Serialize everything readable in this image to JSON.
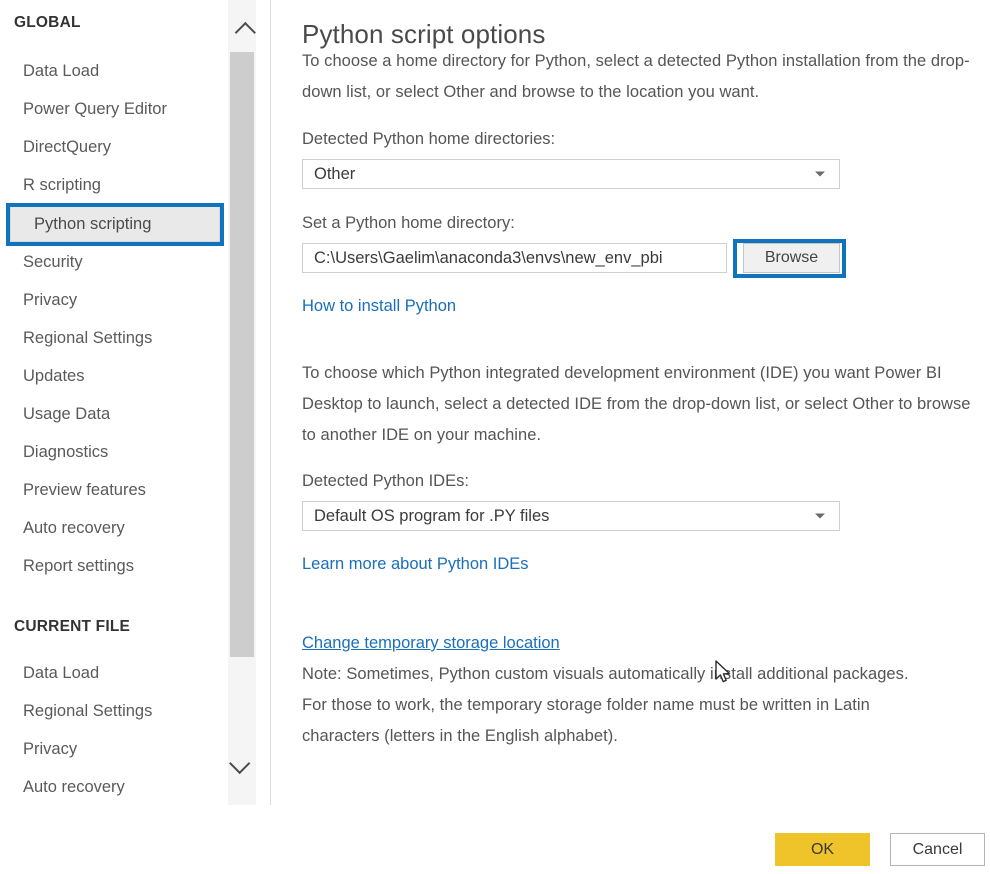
{
  "sidebar": {
    "groups": [
      {
        "title": "GLOBAL",
        "items": [
          {
            "label": "Data Load",
            "selected": false
          },
          {
            "label": "Power Query Editor",
            "selected": false
          },
          {
            "label": "DirectQuery",
            "selected": false
          },
          {
            "label": "R scripting",
            "selected": false
          },
          {
            "label": "Python scripting",
            "selected": true
          },
          {
            "label": "Security",
            "selected": false
          },
          {
            "label": "Privacy",
            "selected": false
          },
          {
            "label": "Regional Settings",
            "selected": false
          },
          {
            "label": "Updates",
            "selected": false
          },
          {
            "label": "Usage Data",
            "selected": false
          },
          {
            "label": "Diagnostics",
            "selected": false
          },
          {
            "label": "Preview features",
            "selected": false
          },
          {
            "label": "Auto recovery",
            "selected": false
          },
          {
            "label": "Report settings",
            "selected": false
          }
        ]
      },
      {
        "title": "CURRENT FILE",
        "items": [
          {
            "label": "Data Load",
            "selected": false
          },
          {
            "label": "Regional Settings",
            "selected": false
          },
          {
            "label": "Privacy",
            "selected": false
          },
          {
            "label": "Auto recovery",
            "selected": false
          }
        ]
      }
    ],
    "scrollbar": {
      "up_arrow_icon": "chevron-up-icon",
      "down_arrow_icon": "chevron-down-icon"
    }
  },
  "main": {
    "title": "Python script options",
    "intro_paragraph": "To choose a home directory for Python, select a detected Python installation from the drop-down list, or select Other and browse to the location you want.",
    "home_dirs_label": "Detected Python home directories:",
    "home_dirs_value": "Other",
    "set_home_label": "Set a Python home directory:",
    "python_home_path": "C:\\Users\\Gaelim\\anaconda3\\envs\\new_env_pbi",
    "browse_label": "Browse",
    "install_link": "How to install Python",
    "ide_paragraph": "To choose which Python integrated development environment (IDE) you want Power BI Desktop to launch, select a detected IDE from the drop-down list, or select Other to browse to another IDE on your machine.",
    "ide_label": "Detected Python IDEs:",
    "ide_value": "Default OS program for .PY files",
    "ide_link": "Learn more about Python IDEs",
    "temp_storage_link": "Change temporary storage location",
    "note_paragraph": "Note: Sometimes, Python custom visuals automatically install additional packages. For those to work, the temporary storage folder name must be written in Latin characters (letters in the English alphabet)."
  },
  "footer": {
    "ok_label": "OK",
    "cancel_label": "Cancel"
  },
  "colors": {
    "accent_yellow": "#efc32a",
    "link_blue": "#1a6fba",
    "annotation_blue": "#0f74bd",
    "selected_item_bg": "#e9e9e9",
    "scrollbar_thumb": "#cdcdcd"
  }
}
